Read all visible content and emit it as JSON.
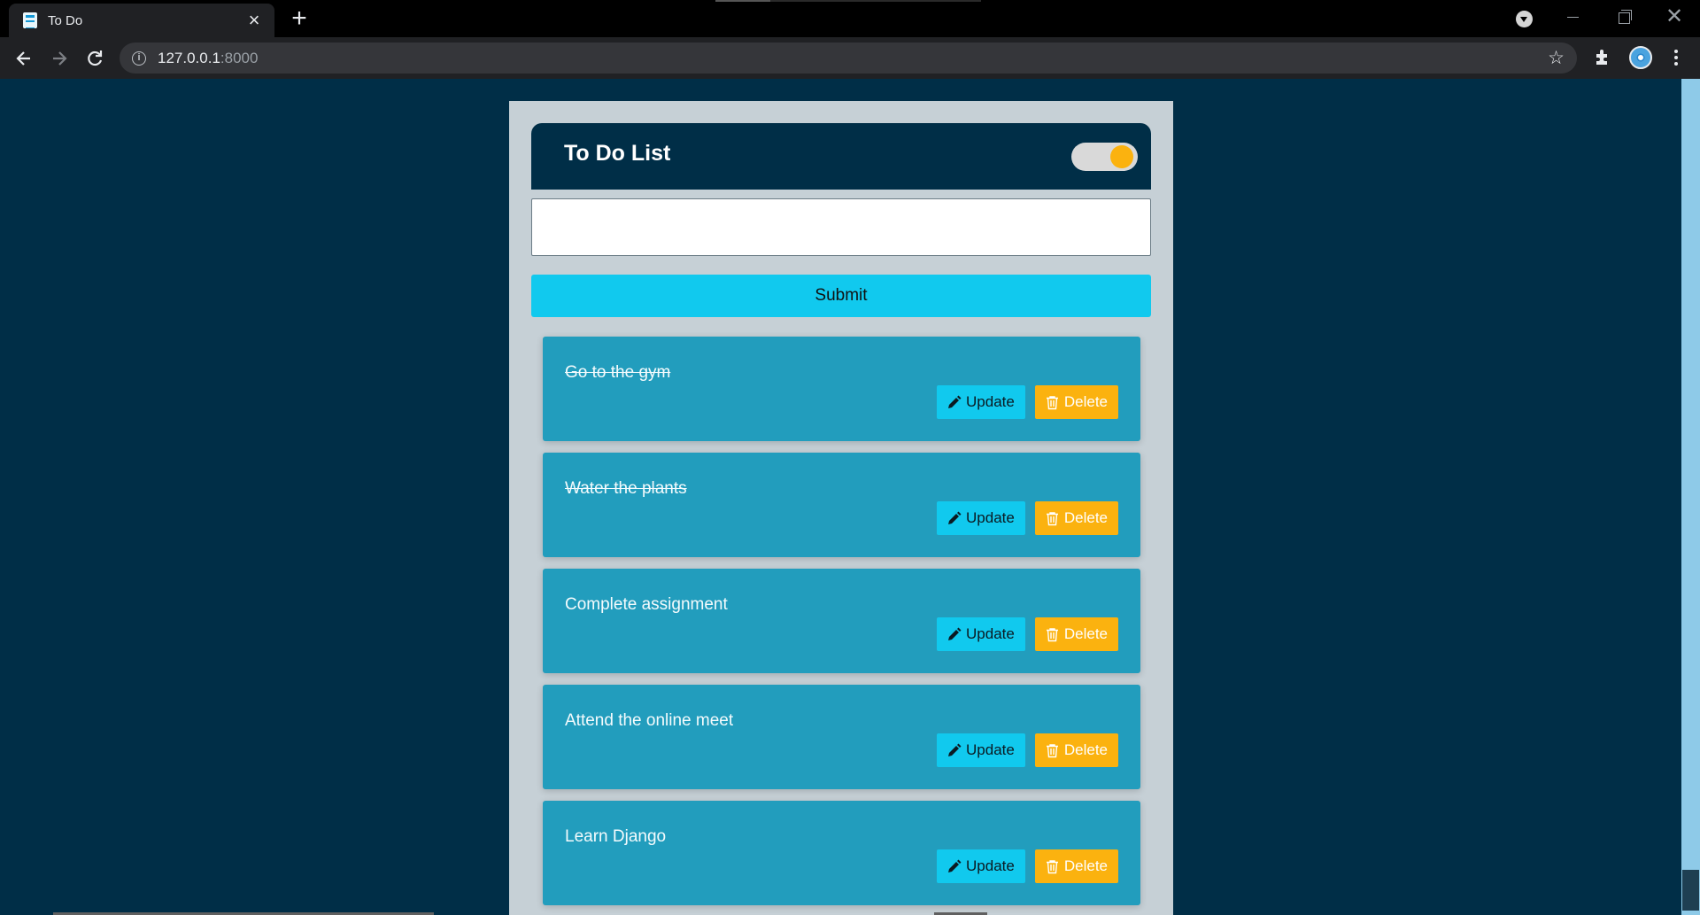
{
  "browser": {
    "tab_title": "To Do",
    "url_host": "127.0.0.1",
    "url_port": ":8000"
  },
  "app": {
    "title": "To Do List",
    "theme_toggle_on": true,
    "input_value": "",
    "submit_label": "Submit",
    "update_label": "Update",
    "delete_label": "Delete",
    "colors": {
      "background": "#002e47",
      "card": "#c6d0d6",
      "task": "#229dbd",
      "accent": "#11c9ee",
      "warning": "#fbb20f"
    }
  },
  "tasks": [
    {
      "text": "Go to the gym",
      "completed": true
    },
    {
      "text": "Water the plants",
      "completed": true
    },
    {
      "text": "Complete assignment",
      "completed": false
    },
    {
      "text": "Attend the online meet",
      "completed": false
    },
    {
      "text": "Learn Django",
      "completed": false
    }
  ]
}
